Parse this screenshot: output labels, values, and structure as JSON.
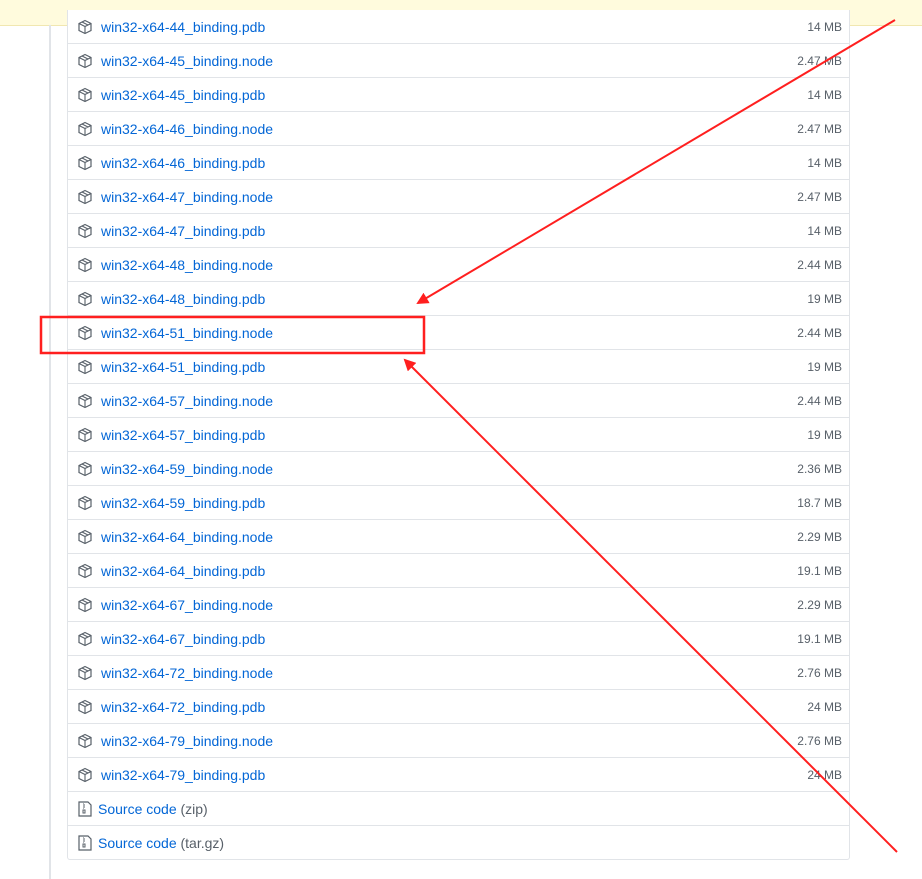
{
  "assets": [
    {
      "name": "win32-x64-44_binding.pdb",
      "size": "14 MB"
    },
    {
      "name": "win32-x64-45_binding.node",
      "size": "2.47 MB"
    },
    {
      "name": "win32-x64-45_binding.pdb",
      "size": "14 MB"
    },
    {
      "name": "win32-x64-46_binding.node",
      "size": "2.47 MB"
    },
    {
      "name": "win32-x64-46_binding.pdb",
      "size": "14 MB"
    },
    {
      "name": "win32-x64-47_binding.node",
      "size": "2.47 MB"
    },
    {
      "name": "win32-x64-47_binding.pdb",
      "size": "14 MB"
    },
    {
      "name": "win32-x64-48_binding.node",
      "size": "2.44 MB"
    },
    {
      "name": "win32-x64-48_binding.pdb",
      "size": "19 MB"
    },
    {
      "name": "win32-x64-51_binding.node",
      "size": "2.44 MB"
    },
    {
      "name": "win32-x64-51_binding.pdb",
      "size": "19 MB"
    },
    {
      "name": "win32-x64-57_binding.node",
      "size": "2.44 MB"
    },
    {
      "name": "win32-x64-57_binding.pdb",
      "size": "19 MB"
    },
    {
      "name": "win32-x64-59_binding.node",
      "size": "2.36 MB"
    },
    {
      "name": "win32-x64-59_binding.pdb",
      "size": "18.7 MB"
    },
    {
      "name": "win32-x64-64_binding.node",
      "size": "2.29 MB"
    },
    {
      "name": "win32-x64-64_binding.pdb",
      "size": "19.1 MB"
    },
    {
      "name": "win32-x64-67_binding.node",
      "size": "2.29 MB"
    },
    {
      "name": "win32-x64-67_binding.pdb",
      "size": "19.1 MB"
    },
    {
      "name": "win32-x64-72_binding.node",
      "size": "2.76 MB"
    },
    {
      "name": "win32-x64-72_binding.pdb",
      "size": "24 MB"
    },
    {
      "name": "win32-x64-79_binding.node",
      "size": "2.76 MB"
    },
    {
      "name": "win32-x64-79_binding.pdb",
      "size": "24 MB"
    }
  ],
  "source_code": [
    {
      "label": "Source code",
      "suffix": "(zip)"
    },
    {
      "label": "Source code",
      "suffix": "(tar.gz)"
    }
  ],
  "colors": {
    "link": "#0366d6",
    "annotation": "#ff1f1f",
    "banner": "#fffbdd"
  },
  "icons": {
    "asset": "package-icon",
    "source": "file-zip-icon"
  },
  "highlighted_asset": "win32-x64-51_binding.node"
}
